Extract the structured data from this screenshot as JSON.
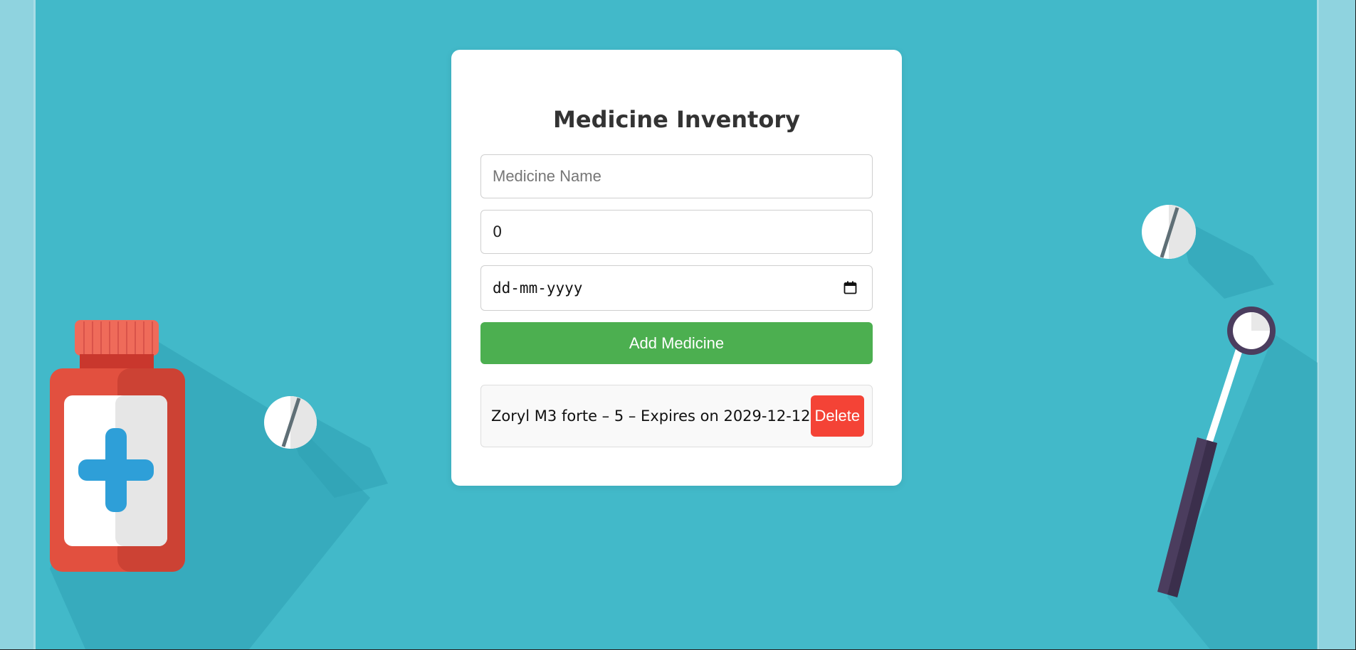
{
  "page": {
    "title": "Medicine Inventory"
  },
  "form": {
    "name_placeholder": "Medicine Name",
    "name_value": "",
    "quantity_value": "0",
    "date_placeholder": "dd-mm-yyyy",
    "add_button_label": "Add Medicine"
  },
  "inventory": {
    "items": [
      {
        "text": "Zoryl M3 forte – 5 – Expires on 2029-12-12",
        "delete_label": "Delete"
      }
    ]
  },
  "icons": {
    "date_picker": "calendar-icon"
  },
  "colors": {
    "background": "#42b9c9",
    "add_button": "#4caf50",
    "delete_button": "#f44336",
    "title_text": "#333333"
  }
}
